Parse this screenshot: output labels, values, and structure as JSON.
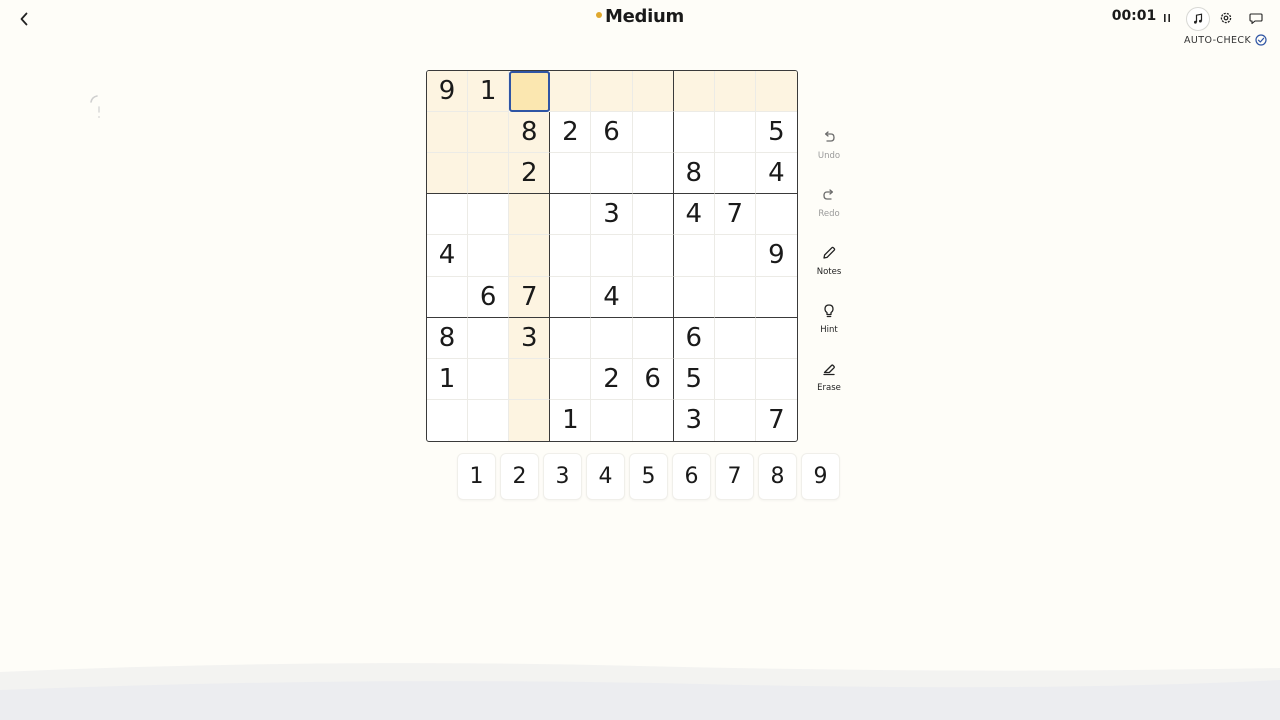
{
  "header": {
    "title": "Medium",
    "timer": "00:01",
    "autocheck_label": "AUTO-CHECK"
  },
  "board": {
    "selected": [
      0,
      2
    ],
    "highlight_color": "#fdf4e1",
    "selected_color": "#fbe7b0",
    "selected_outline_color": "#2f55a4",
    "rows": [
      [
        "9",
        "1",
        "",
        "",
        "",
        "",
        "",
        "",
        ""
      ],
      [
        "",
        "",
        "8",
        "2",
        "6",
        "",
        "",
        "",
        "5"
      ],
      [
        "",
        "",
        "2",
        "",
        "",
        "",
        "8",
        "",
        "4"
      ],
      [
        "",
        "",
        "",
        "",
        "3",
        "",
        "4",
        "7",
        ""
      ],
      [
        "4",
        "",
        "",
        "",
        "",
        "",
        "",
        "",
        "9"
      ],
      [
        "",
        "6",
        "7",
        "",
        "4",
        "",
        "",
        "",
        ""
      ],
      [
        "8",
        "",
        "3",
        "",
        "",
        "",
        "6",
        "",
        ""
      ],
      [
        "1",
        "",
        "",
        "",
        "2",
        "6",
        "5",
        "",
        ""
      ],
      [
        "",
        "",
        "",
        "1",
        "",
        "",
        "3",
        "",
        "7"
      ]
    ]
  },
  "tools": [
    {
      "id": "undo",
      "label": "Undo",
      "icon": "undo-icon",
      "disabled": true
    },
    {
      "id": "redo",
      "label": "Redo",
      "icon": "redo-icon",
      "disabled": true
    },
    {
      "id": "notes",
      "label": "Notes",
      "icon": "pencil-icon",
      "disabled": false
    },
    {
      "id": "hint",
      "label": "Hint",
      "icon": "lightbulb-icon",
      "disabled": false
    },
    {
      "id": "erase",
      "label": "Erase",
      "icon": "eraser-icon",
      "disabled": false
    }
  ],
  "numpad": [
    "1",
    "2",
    "3",
    "4",
    "5",
    "6",
    "7",
    "8",
    "9"
  ],
  "colors": {
    "accent_dot": "#e0a82e",
    "autocheck_check": "#2f55a4"
  }
}
